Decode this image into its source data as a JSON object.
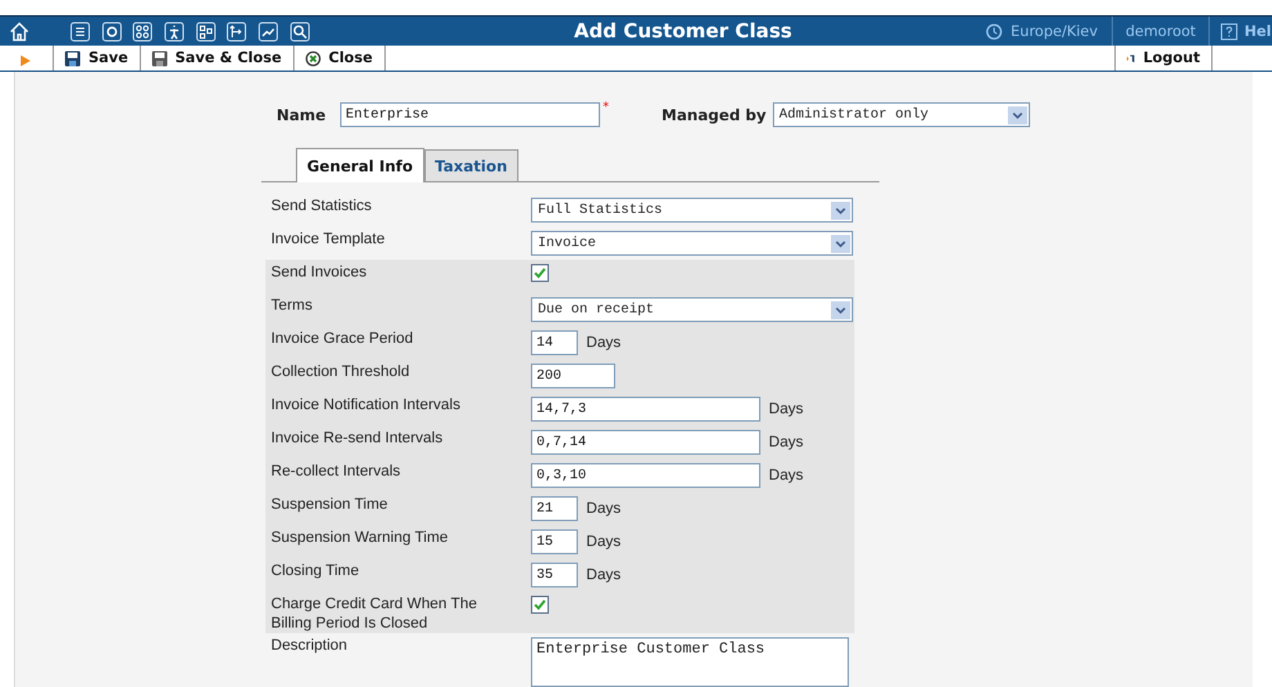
{
  "header": {
    "title": "Add Customer Class",
    "timezone": "Europe/Kiev",
    "user": "demoroot",
    "help": "Hel"
  },
  "toolbar": {
    "buttons": [
      {
        "label": "Save",
        "kind": "save"
      },
      {
        "label": "Save & Close",
        "kind": "save-close"
      },
      {
        "label": "Close",
        "kind": "close"
      }
    ],
    "logout": "Logout"
  },
  "name": {
    "label": "Name",
    "value": "Enterprise",
    "required_mark": "*"
  },
  "managed_by": {
    "label": "Managed by",
    "value": "Administrator only"
  },
  "tabs": [
    {
      "label": "General Info",
      "selected": true
    },
    {
      "label": "Taxation",
      "selected": false
    }
  ],
  "rows": [
    {
      "label": "Send Statistics",
      "kind": "select",
      "value": "Full Statistics",
      "shaded": false
    },
    {
      "label": "Invoice Template",
      "kind": "select",
      "value": "Invoice",
      "shaded": false
    },
    {
      "label": "Send Invoices",
      "kind": "check",
      "checked": true,
      "shaded": true
    },
    {
      "label": "Terms",
      "kind": "select",
      "value": "Due on receipt",
      "shaded": true
    },
    {
      "label": "Invoice Grace Period",
      "kind": "short",
      "value": "14",
      "suffix": "Days",
      "shaded": true
    },
    {
      "label": "Collection Threshold",
      "kind": "medium",
      "value": "200",
      "shaded": true
    },
    {
      "label": "Invoice Notification Intervals",
      "kind": "wide",
      "value": "14,7,3",
      "suffix": "Days",
      "shaded": true
    },
    {
      "label": "Invoice Re-send Intervals",
      "kind": "wide",
      "value": "0,7,14",
      "suffix": "Days",
      "shaded": true
    },
    {
      "label": "Re-collect Intervals",
      "kind": "wide",
      "value": "0,3,10",
      "suffix": "Days",
      "shaded": true
    },
    {
      "label": "Suspension Time",
      "kind": "short",
      "value": "21",
      "suffix": "Days",
      "shaded": true
    },
    {
      "label": "Suspension Warning Time",
      "kind": "short",
      "value": "15",
      "suffix": "Days",
      "shaded": true
    },
    {
      "label": "Closing Time",
      "kind": "short",
      "value": "35",
      "suffix": "Days",
      "shaded": true
    },
    {
      "label": "Charge Credit Card When The Billing Period Is Closed",
      "kind": "check",
      "checked": true,
      "shaded": true
    },
    {
      "label": "Description",
      "kind": "area",
      "value": "Enterprise Customer Class",
      "shaded": false
    }
  ]
}
